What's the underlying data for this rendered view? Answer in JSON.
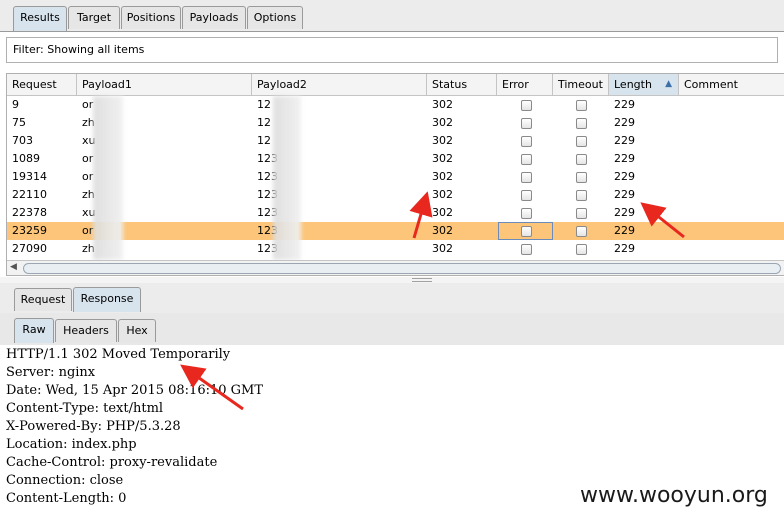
{
  "top_tabs": [
    "Results",
    "Target",
    "Positions",
    "Payloads",
    "Options"
  ],
  "filter": {
    "label": "Filter:",
    "text": "Showing all items"
  },
  "columns": [
    "Request",
    "Payload1",
    "Payload2",
    "Status",
    "Error",
    "Timeout",
    "Length",
    "Comment"
  ],
  "sorted_column": "Length",
  "rows": [
    {
      "request": "9",
      "payload1": "or",
      "payload2": "12",
      "status": "302",
      "length": "229"
    },
    {
      "request": "75",
      "payload1": "zh",
      "payload2": "12",
      "status": "302",
      "length": "229"
    },
    {
      "request": "703",
      "payload1": "xu",
      "payload2": "12",
      "status": "302",
      "length": "229"
    },
    {
      "request": "1089",
      "payload1": "or",
      "payload2": "123",
      "status": "302",
      "length": "229"
    },
    {
      "request": "19314",
      "payload1": "or",
      "payload2": "123",
      "status": "302",
      "length": "229"
    },
    {
      "request": "22110",
      "payload1": "zh",
      "payload2": "123",
      "status": "302",
      "length": "229"
    },
    {
      "request": "22378",
      "payload1": "xu",
      "payload2": "123",
      "status": "302",
      "length": "229"
    },
    {
      "request": "23259",
      "payload1": "or",
      "payload2": "123",
      "status": "302",
      "length": "229",
      "selected": true
    },
    {
      "request": "27090",
      "payload1": "zh",
      "payload2": "123",
      "status": "302",
      "length": "229"
    }
  ],
  "message_tabs": [
    "Request",
    "Response"
  ],
  "selected_message_tab": "Response",
  "view_tabs": [
    "Raw",
    "Headers",
    "Hex"
  ],
  "selected_view_tab": "Raw",
  "response_lines": [
    "HTTP/1.1 302 Moved Temporarily",
    "Server: nginx",
    "Date: Wed, 15 Apr 2015 08:16:10 GMT",
    "Content-Type: text/html",
    "X-Powered-By: PHP/5.3.28",
    "Location: index.php",
    "Cache-Control: proxy-revalidate",
    "Connection: close",
    "Content-Length: 0"
  ],
  "watermark": "www.wooyun.org",
  "colors": {
    "selected_row": "#fcc57a",
    "selected_tab": "#d7e4ee",
    "annotation_arrow": "#e8281e"
  }
}
